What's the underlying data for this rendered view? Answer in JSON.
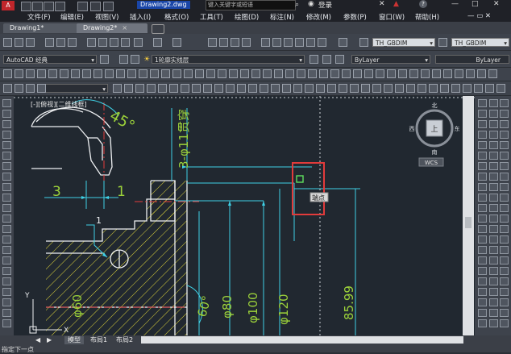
{
  "titlebar": {
    "document_title": "Drawing2.dwg",
    "search_placeholder": "键入关键字或短语",
    "login_label": "登录"
  },
  "menu": [
    "文件(F)",
    "编辑(E)",
    "视图(V)",
    "插入(I)",
    "格式(O)",
    "工具(T)",
    "绘图(D)",
    "标注(N)",
    "修改(M)",
    "参数(P)",
    "窗口(W)",
    "帮助(H)"
  ],
  "tabs": [
    {
      "label": "Drawing1*",
      "close": "×"
    },
    {
      "label": "Drawing2*",
      "close": "×"
    }
  ],
  "toolbar": {
    "text_style": "TH_GBDIM",
    "dim_style": "TH_GBDIM",
    "workspace": "AutoCAD 经典",
    "layer": "1轮廓实线层",
    "color": "ByLayer",
    "linetype": "ByLayer"
  },
  "viewport": {
    "label": "[-][俯视][二维线框]",
    "viewcube_face": "上",
    "viewcube_n": "北",
    "viewcube_s": "南",
    "viewcube_e": "东",
    "viewcube_w": "西",
    "wcs": "WCS"
  },
  "drawing": {
    "dim_45": "45°",
    "dim_3": "3",
    "dim_1": "1",
    "dim_thread": "3-φ11贯穿",
    "dim_60deg": "60°",
    "dim_phi60": "φ60",
    "dim_phi80": "φ80",
    "dim_phi100": "φ100",
    "dim_phi120": "φ120",
    "dim_8599": "85.99",
    "marker_1": "1",
    "snap_tip": "端点",
    "label_x": "X",
    "label_y": "Y"
  },
  "layout_tabs": [
    "模型",
    "布局1",
    "布局2"
  ],
  "command_line": "指定下一点"
}
